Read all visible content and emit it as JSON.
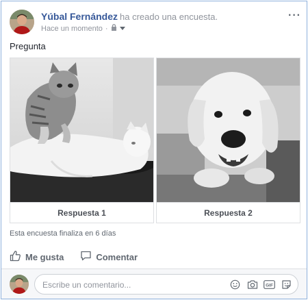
{
  "post": {
    "author": "Yúbal Fernández",
    "action": "ha creado una encuesta.",
    "timestamp": "Hace un momento",
    "privacy_icon": "lock-icon",
    "more_icon": "more-options-icon",
    "more_label": "···"
  },
  "poll": {
    "question": "Pregunta",
    "options": [
      {
        "label": "Respuesta 1",
        "image": "kittens-photo"
      },
      {
        "label": "Respuesta 2",
        "image": "puppy-photo"
      }
    ],
    "ends": "Esta encuesta finaliza en 6 días"
  },
  "actions": {
    "like_label": "Me gusta",
    "comment_label": "Comentar"
  },
  "comment": {
    "placeholder": "Escribe un comentario...",
    "icons": [
      "emoji-icon",
      "camera-icon",
      "gif-icon",
      "sticker-icon"
    ]
  },
  "colors": {
    "author": "#365899",
    "border": "#8fb1dc",
    "muted": "#90949c"
  }
}
